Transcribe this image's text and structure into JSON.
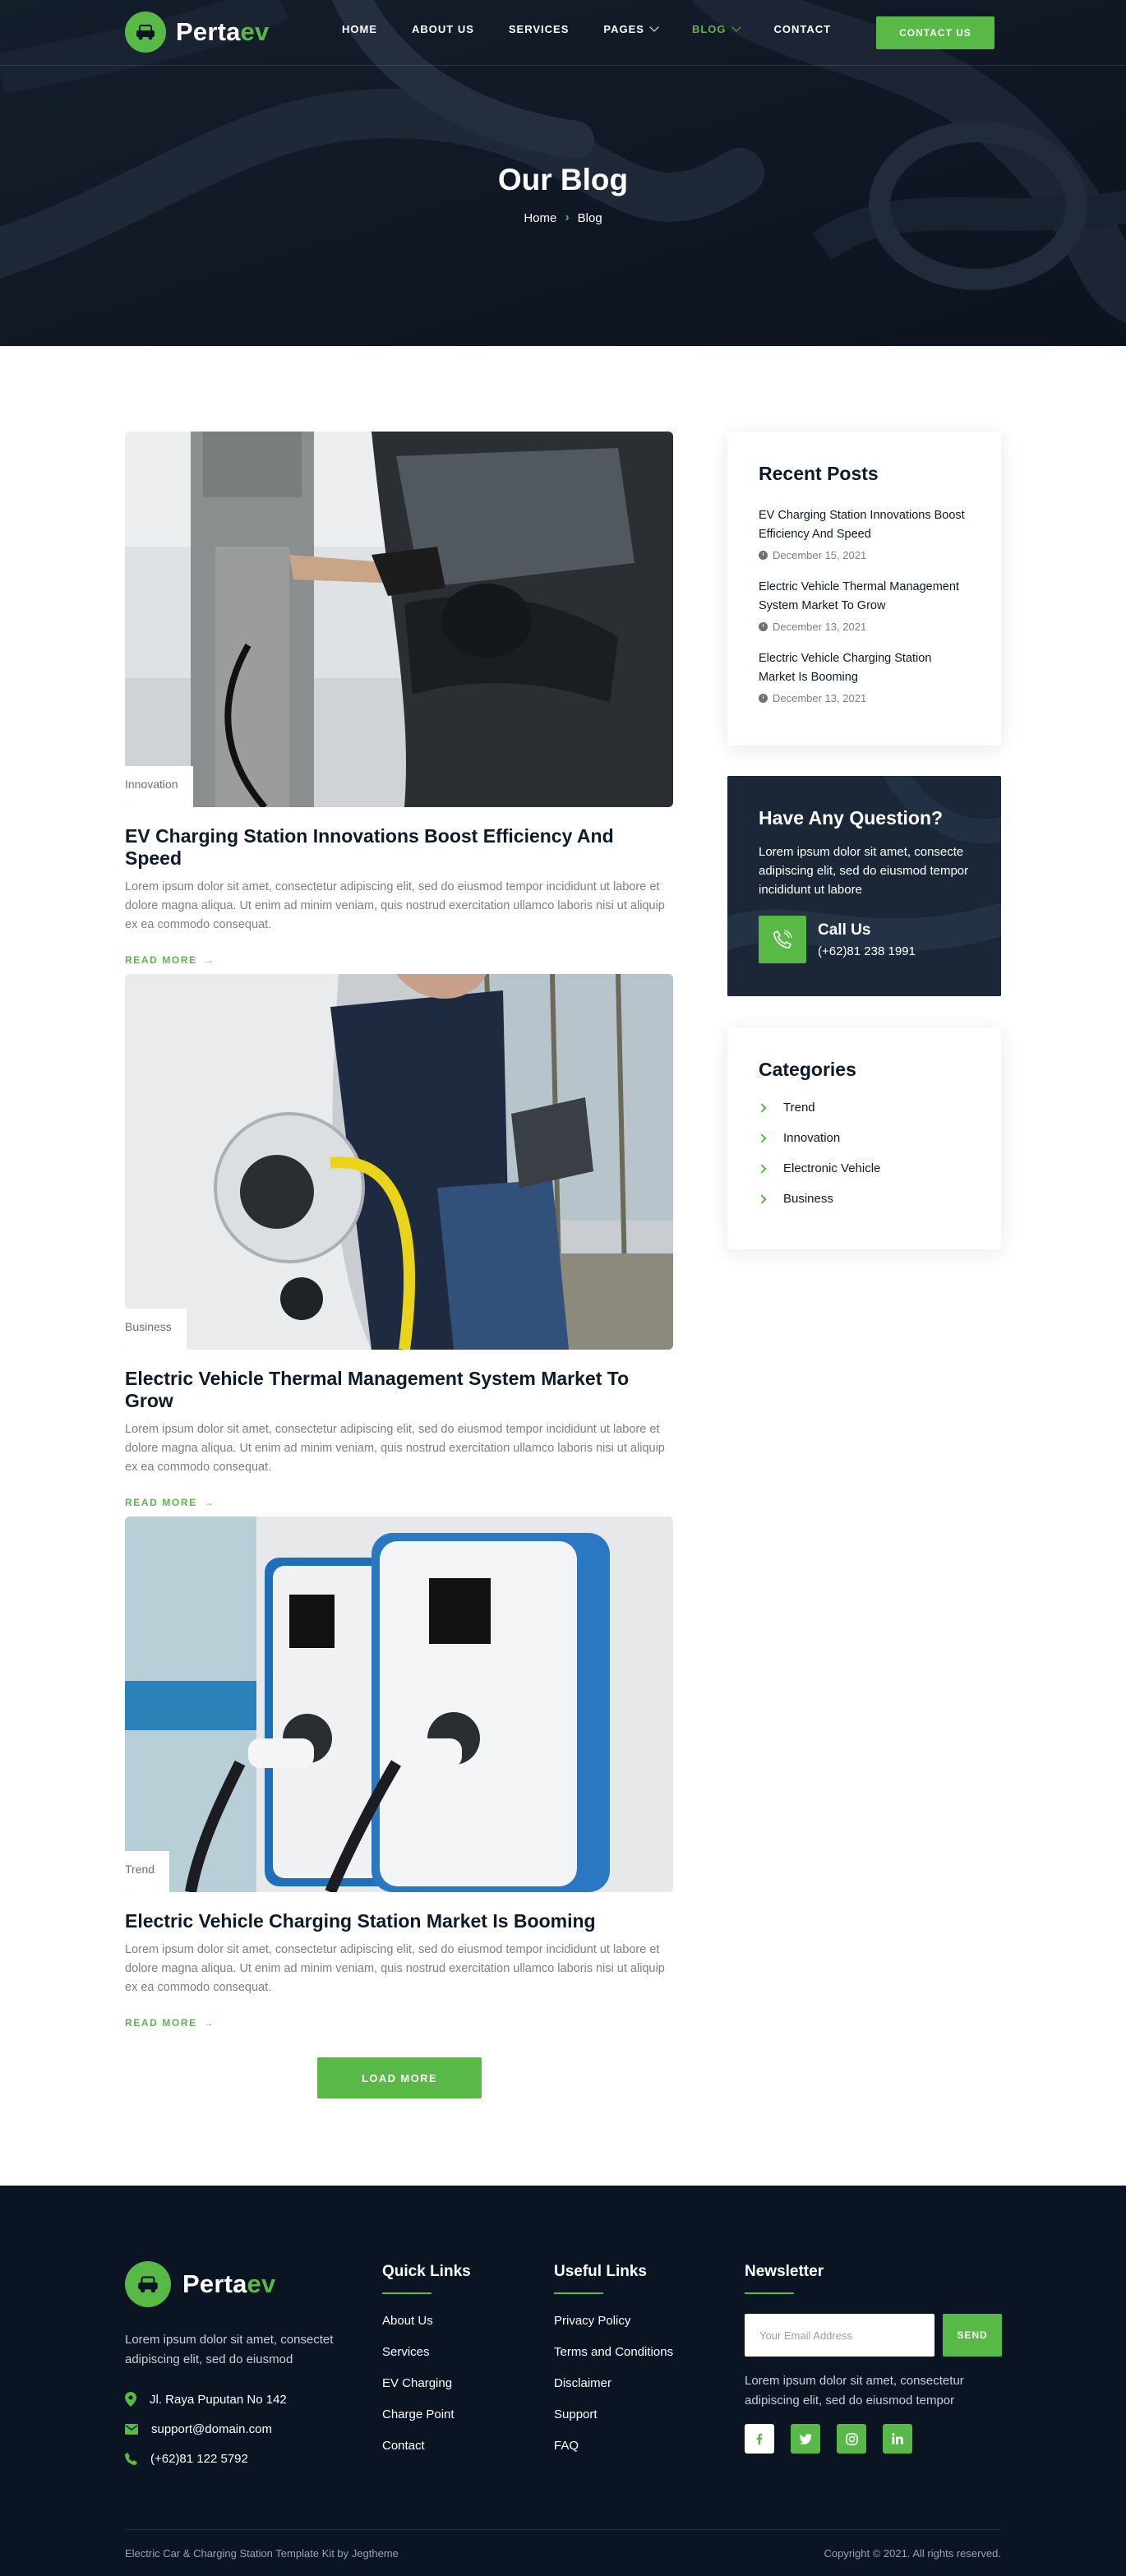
{
  "colors": {
    "brand_green": "#58b947",
    "navy": "#0a1422",
    "text_dark": "#0d1a2a",
    "text_muted": "#7b8087"
  },
  "header": {
    "logo": {
      "name_main": "Perta",
      "name_accent": "ev",
      "icon": "ev-car-icon"
    },
    "nav": [
      {
        "label": "HOME",
        "active": false,
        "has_dropdown": false
      },
      {
        "label": "ABOUT US",
        "active": false,
        "has_dropdown": false
      },
      {
        "label": "SERVICES",
        "active": false,
        "has_dropdown": false
      },
      {
        "label": "PAGES",
        "active": false,
        "has_dropdown": true
      },
      {
        "label": "BLOG",
        "active": true,
        "has_dropdown": true
      },
      {
        "label": "CONTACT",
        "active": false,
        "has_dropdown": false
      }
    ],
    "cta_label": "CONTACT US"
  },
  "hero": {
    "title": "Our Blog",
    "breadcrumb": {
      "home": "Home",
      "current": "Blog"
    }
  },
  "posts": [
    {
      "tag": "Innovation",
      "title": "EV Charging Station Innovations Boost Efficiency And Speed",
      "excerpt": "Lorem ipsum dolor sit amet, consectetur adipiscing elit, sed do eiusmod tempor incididunt ut labore et dolore magna aliqua. Ut enim ad minim veniam, quis nostrud exercitation ullamco laboris nisi ut aliquip ex ea commodo consequat.",
      "read_more": "READ MORE"
    },
    {
      "tag": "Business",
      "title": "Electric Vehicle Thermal Management System Market To Grow",
      "excerpt": "Lorem ipsum dolor sit amet, consectetur adipiscing elit, sed do eiusmod tempor incididunt ut labore et dolore magna aliqua. Ut enim ad minim veniam, quis nostrud exercitation ullamco laboris nisi ut aliquip ex ea commodo consequat.",
      "read_more": "READ MORE"
    },
    {
      "tag": "Trend",
      "title": "Electric Vehicle Charging Station Market Is Booming",
      "excerpt": "Lorem ipsum dolor sit amet, consectetur adipiscing elit, sed do eiusmod tempor incididunt ut labore et dolore magna aliqua. Ut enim ad minim veniam, quis nostrud exercitation ullamco laboris nisi ut aliquip ex ea commodo consequat.",
      "read_more": "READ MORE"
    }
  ],
  "load_more_label": "LOAD MORE",
  "sidebar": {
    "recent": {
      "title": "Recent Posts",
      "items": [
        {
          "title": "EV Charging Station Innovations Boost Efficiency And Speed",
          "date": "December 15, 2021"
        },
        {
          "title": "Electric Vehicle Thermal Management System Market To Grow",
          "date": "December 13, 2021"
        },
        {
          "title": "Electric Vehicle Charging Station Market Is Booming",
          "date": "December 13, 2021"
        }
      ]
    },
    "question": {
      "title": "Have Any Question?",
      "text": "Lorem ipsum dolor sit amet, consecte adipiscing elit, sed do eiusmod tempor incididunt ut labore",
      "call_title": "Call Us",
      "phone": "(+62)81 238 1991"
    },
    "categories": {
      "title": "Categories",
      "items": [
        "Trend",
        "Innovation",
        "Electronic Vehicle",
        "Business"
      ]
    }
  },
  "footer": {
    "about": "Lorem ipsum dolor sit amet, consectet adipiscing elit, sed do eiusmod",
    "contact": {
      "address": "Jl. Raya Puputan No 142",
      "email": "support@domain.com",
      "phone": "(+62)81 122 5792"
    },
    "quick_links": {
      "title": "Quick Links",
      "items": [
        "About Us",
        "Services",
        "EV Charging",
        "Charge Point",
        "Contact"
      ]
    },
    "useful_links": {
      "title": "Useful Links",
      "items": [
        "Privacy Policy",
        "Terms and Conditions",
        "Disclaimer",
        "Support",
        "FAQ"
      ]
    },
    "newsletter": {
      "title": "Newsletter",
      "placeholder": "Your Email Address",
      "send_label": "SEND",
      "text": "Lorem ipsum dolor sit amet, consectetur adipiscing elit, sed do eiusmod tempor",
      "socials": [
        "facebook-icon",
        "twitter-icon",
        "instagram-icon",
        "linkedin-icon"
      ]
    },
    "credit": "Electric Car & Charging Station Template Kit by Jegtheme",
    "copyright": "Copyright © 2021. All rights reserved."
  }
}
